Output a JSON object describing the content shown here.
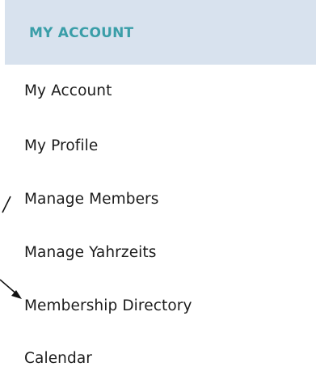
{
  "header": {
    "title": "MY ACCOUNT"
  },
  "menu": {
    "items": [
      {
        "label": "My Account"
      },
      {
        "label": "My Profile"
      },
      {
        "label": "Manage Members"
      },
      {
        "label": "Manage Yahrzeits"
      },
      {
        "label": "Membership Directory"
      },
      {
        "label": "Calendar"
      }
    ]
  },
  "colors": {
    "header_bg": "#d8e2ee",
    "header_text": "#3a9ea8",
    "item_text": "#1c1c1c"
  },
  "annotations": [
    {
      "name": "annotation-arrow",
      "points_to": "Membership Directory"
    }
  ]
}
